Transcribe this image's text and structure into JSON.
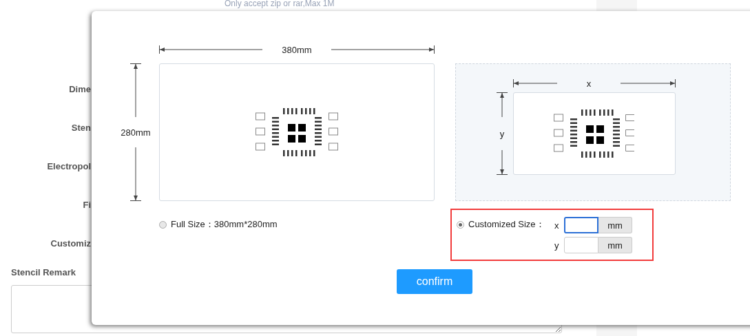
{
  "background_form": {
    "upload_hint": "Only accept zip or rar,Max 1M",
    "labels": [
      "Dime",
      "Sten",
      "Electropol",
      "Fi",
      "Customiz"
    ],
    "remark_label": "Stencil Remark"
  },
  "dialog": {
    "full_size": {
      "width_label": "380mm",
      "height_label": "280mm",
      "option_label": "Full Size：380mm*280mm",
      "selected": false
    },
    "customized_size": {
      "width_label": "x",
      "height_label": "y",
      "option_label": "Customized Size：",
      "selected": true,
      "highlighted": true,
      "fields": [
        {
          "axis": "x",
          "unit": "mm",
          "focused": true
        },
        {
          "axis": "y",
          "unit": "mm",
          "focused": false
        }
      ]
    },
    "confirm_button": "confirm"
  }
}
